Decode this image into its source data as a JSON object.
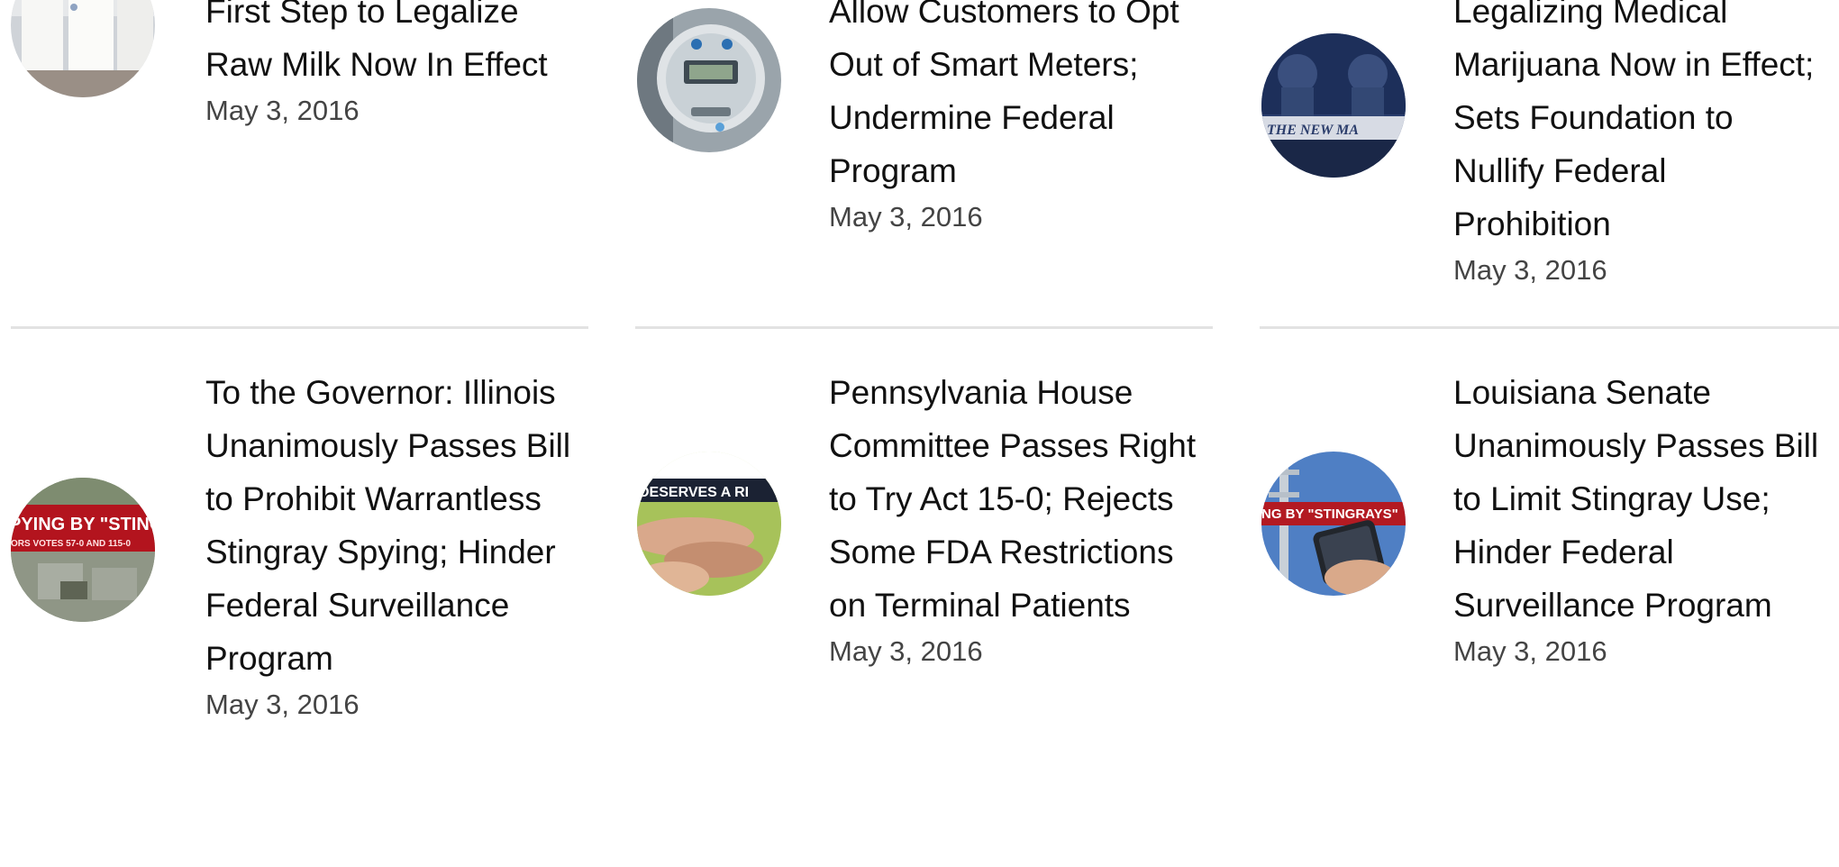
{
  "articles_row1": [
    {
      "title_lines": [
        "First Step to Legalize",
        "Raw Milk Now In Effect"
      ],
      "date": "May 3, 2016",
      "thumbnail": "milk-bottles-image"
    },
    {
      "title_lines": [
        "Allow Customers to Opt",
        "Out of Smart Meters;",
        "Undermine Federal",
        "Program"
      ],
      "date": "May 3, 2016",
      "thumbnail": "smart-meter-image"
    },
    {
      "title_lines": [
        "Legalizing Medical",
        "Marijuana Now in Effect;",
        "Sets Foundation to",
        "Nullify Federal",
        "Prohibition"
      ],
      "date": "May 3, 2016",
      "thumbnail": "riot-police-image",
      "thumbnail_text": "THE NEW MA"
    }
  ],
  "articles_row2": [
    {
      "title_lines": [
        "To the Governor: Illinois",
        "Unanimously Passes Bill",
        "to Prohibit Warrantless",
        "Stingray Spying; Hinder",
        "Federal Surveillance",
        "Program"
      ],
      "date": "May 3, 2016",
      "thumbnail": "stingray-spying-banner-image",
      "thumbnail_text": "PYING BY \"STING",
      "thumbnail_subtext": "ORS VOTES 57-0 AND 115-0"
    },
    {
      "title_lines": [
        "Pennsylvania House",
        "Committee Passes Right",
        "to Try Act 15-0; Rejects",
        "Some FDA Restrictions",
        "on Terminal Patients"
      ],
      "date": "May 3, 2016",
      "thumbnail": "holding-hands-image",
      "thumbnail_text": "DESERVES A RI"
    },
    {
      "title_lines": [
        "Louisiana Senate",
        "Unanimously Passes Bill",
        "to Limit Stingray Use;",
        "Hinder Federal",
        "Surveillance Program"
      ],
      "date": "May 3, 2016",
      "thumbnail": "cell-tower-phone-image",
      "thumbnail_text": "NG BY \"STINGRAYS\""
    }
  ]
}
